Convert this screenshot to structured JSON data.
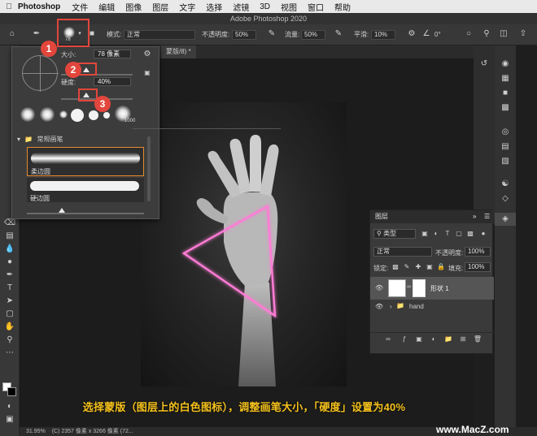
{
  "menubar": {
    "app_name": "Photoshop",
    "items": [
      "文件",
      "编辑",
      "图像",
      "图层",
      "文字",
      "选择",
      "滤镜",
      "3D",
      "视图",
      "窗口",
      "帮助"
    ]
  },
  "window": {
    "title": "Adobe Photoshop 2020"
  },
  "options_bar": {
    "brush_size": "78",
    "mode_label": "模式:",
    "mode_value": "正常",
    "opacity_label": "不透明度:",
    "opacity_value": "50%",
    "flow_label": "流量:",
    "flow_value": "50%",
    "smoothing_label": "平滑:",
    "smoothing_value": "10%",
    "angle_value": "0°"
  },
  "document_tab": {
    "label": "蒙版/8) *"
  },
  "brush_picker": {
    "size_label": "大小:",
    "size_value": "78 像素",
    "hardness_label": "硬度:",
    "hardness_value": "40%",
    "preset_number": "1000",
    "folder_label": "常规画笔",
    "brushes": [
      "柔边圆",
      "硬边圆"
    ]
  },
  "callouts": [
    "1",
    "2",
    "3"
  ],
  "layers_panel": {
    "title": "图层",
    "filter_value": "类型",
    "blend_mode": "正常",
    "opacity_label": "不透明度:",
    "opacity_value": "100%",
    "lock_label": "锁定:",
    "fill_label": "填充:",
    "fill_value": "100%",
    "layers": [
      {
        "name": "形状 1"
      },
      {
        "name": "hand"
      }
    ]
  },
  "status_bar": {
    "zoom": "31.95%",
    "info": "(C) 2357 像素 x 3266 像素 (72..."
  },
  "caption": "选择蒙版（图层上的白色图标），调整画笔大小，「硬度」设置为40%",
  "watermark": "www.MacZ.com",
  "colors": {
    "callout_red": "#e2463c",
    "neon_pink": "#ff7bd6",
    "caption_yellow": "#f6c21d"
  }
}
